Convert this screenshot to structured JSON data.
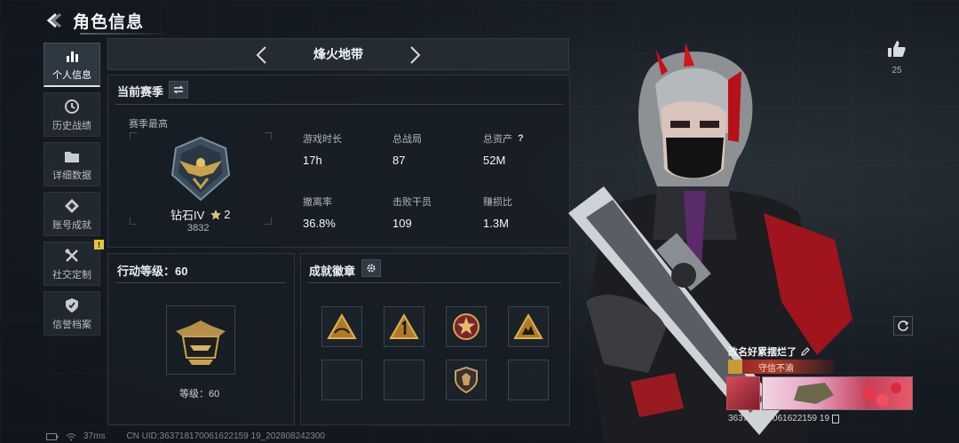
{
  "header": {
    "title": "角色信息"
  },
  "sidebar": {
    "items": [
      {
        "label": "个人信息",
        "icon": "bar-chart-icon",
        "active": true
      },
      {
        "label": "历史战绩",
        "icon": "history-icon",
        "active": false
      },
      {
        "label": "详细数据",
        "icon": "folder-icon",
        "active": false
      },
      {
        "label": "账号成就",
        "icon": "achievement-icon",
        "active": false
      },
      {
        "label": "社交定制",
        "icon": "tools-icon",
        "active": false,
        "badge": "!"
      },
      {
        "label": "信誉档案",
        "icon": "shield-icon",
        "active": false
      }
    ]
  },
  "map_selector": {
    "name": "烽火地带"
  },
  "season": {
    "title": "当前赛季",
    "best_label": "赛季最高",
    "rank_name": "钻石IV",
    "rank_stars": "2",
    "rank_points": "3832",
    "stats": [
      {
        "label": "游戏时长",
        "value": "17h"
      },
      {
        "label": "总战局",
        "value": "87"
      },
      {
        "label": "总资产",
        "value": "52M",
        "help": "?"
      },
      {
        "label": "撤离率",
        "value": "36.8%"
      },
      {
        "label": "击败干员",
        "value": "109"
      },
      {
        "label": "赚损比",
        "value": "1.3M"
      }
    ]
  },
  "action_level": {
    "title": "行动等级：60",
    "level_label": "等级：60"
  },
  "achievements": {
    "title": "成就徽章"
  },
  "likes": {
    "count": "25"
  },
  "profile": {
    "nickname": "改名好累摆烂了",
    "title_tag": "守信不渝",
    "uid": "363718170061622159 19"
  },
  "footer": {
    "ping": "37ms",
    "uid": "CN UID:363718170061622159 19_202808242300"
  },
  "colors": {
    "accent": "#dfe3e6",
    "warning": "#e8c23a",
    "panel": "#181e25"
  }
}
